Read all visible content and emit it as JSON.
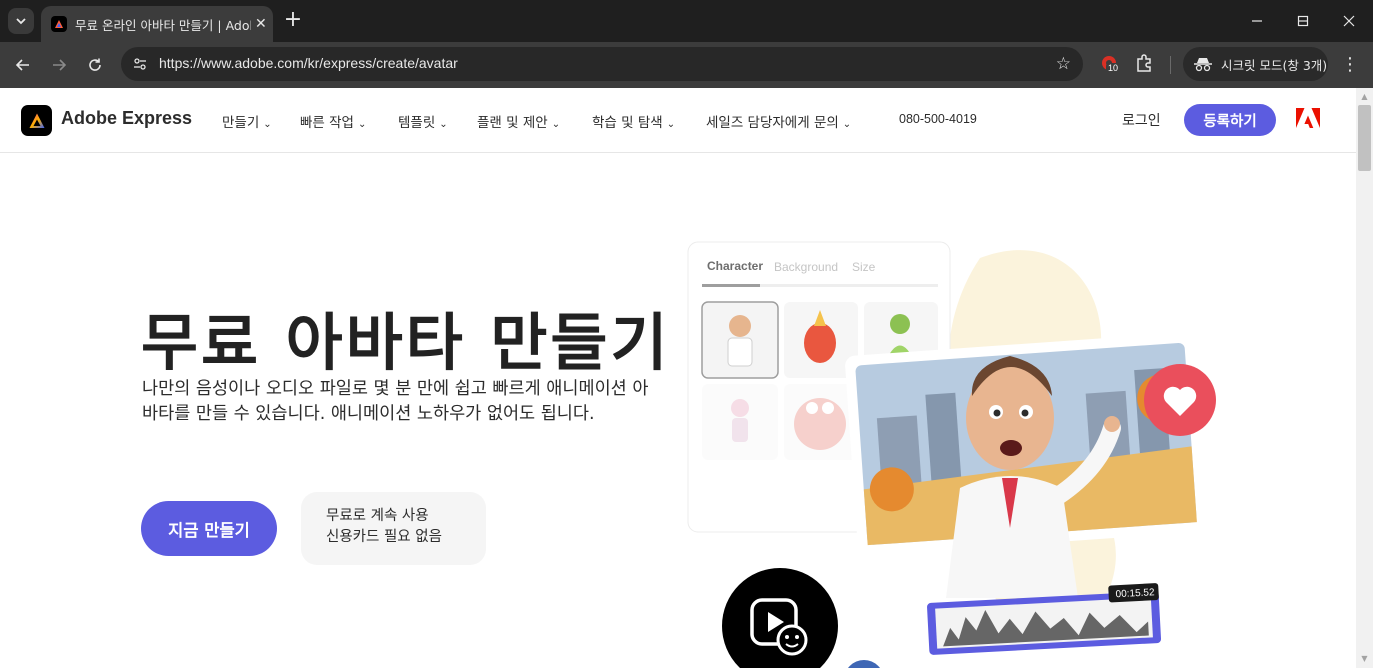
{
  "browser": {
    "tab_title": "무료 온라인 아바타 만들기 | Adobe Express",
    "url": "https://www.adobe.com/kr/express/create/avatar",
    "extension_badge": "10",
    "incognito_label": "시크릿 모드(창 3개)"
  },
  "header": {
    "brand": "Adobe Express",
    "nav": [
      "만들기",
      "빠른 작업",
      "템플릿",
      "플랜 및 제안",
      "학습 및 탐색",
      "세일즈 담당자에게 문의"
    ],
    "phone": "080-500-4019",
    "login": "로그인",
    "signup": "등록하기"
  },
  "hero": {
    "title": "무료 아바타 만들기",
    "description": "나만의 음성이나 오디오 파일로 몇 분 만에 쉽고 빠르게 애니메이션 아바타를 만들 수 있습니다. 애니메이션 노하우가 없어도 됩니다.",
    "cta": "지금 만들기",
    "note_line1": "무료로 계속 사용",
    "note_line2": "신용카드 필요 없음"
  },
  "illustration": {
    "tabs": [
      "Character",
      "Background",
      "Size"
    ],
    "timecode": "00:15.52"
  },
  "colors": {
    "accent": "#5c5ce0",
    "adobe_red": "#eb1000",
    "heart": "#ea4f5c"
  }
}
